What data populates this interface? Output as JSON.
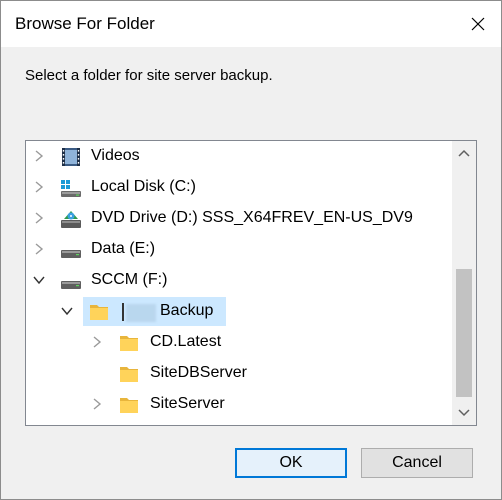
{
  "window": {
    "title": "Browse For Folder",
    "close_icon": "close-icon"
  },
  "instruction": "Select a folder for site server backup.",
  "tree": {
    "items": [
      {
        "label": "Videos",
        "icon": "videos-folder-icon",
        "expander": "collapsed"
      },
      {
        "label": "Local Disk (C:)",
        "icon": "local-disk-icon",
        "expander": "collapsed"
      },
      {
        "label": "DVD Drive (D:) SSS_X64FREV_EN-US_DV9",
        "icon": "dvd-drive-icon",
        "expander": "collapsed"
      },
      {
        "label": "Data (E:)",
        "icon": "drive-icon",
        "expander": "collapsed"
      },
      {
        "label": "SCCM (F:)",
        "icon": "drive-icon",
        "expander": "expanded"
      },
      {
        "label": "Backup",
        "icon": "folder-icon",
        "expander": "expanded",
        "selected": true
      },
      {
        "label": "CD.Latest",
        "icon": "folder-icon",
        "expander": "collapsed"
      },
      {
        "label": "SiteDBServer",
        "icon": "folder-icon",
        "expander": "none"
      },
      {
        "label": "SiteServer",
        "icon": "folder-icon",
        "expander": "collapsed"
      }
    ]
  },
  "buttons": {
    "ok": "OK",
    "cancel": "Cancel"
  },
  "colors": {
    "selection": "#cce8ff",
    "default_button_border": "#0078d7",
    "folder": "#ffd35a"
  }
}
